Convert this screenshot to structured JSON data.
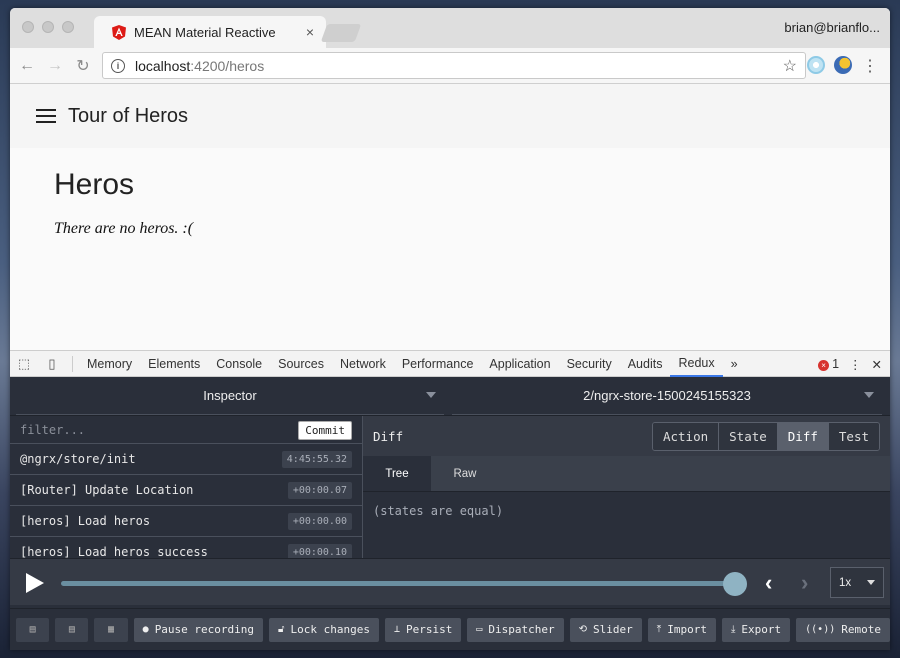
{
  "browser": {
    "tab_title": "MEAN Material Reactive",
    "profile": "brian@brianflo...",
    "url_host": "localhost",
    "url_path": ":4200/heros"
  },
  "app": {
    "title": "Tour of Heros",
    "heading": "Heros",
    "empty_message": "There are no heros. :("
  },
  "devtools": {
    "tabs": [
      "Memory",
      "Elements",
      "Console",
      "Sources",
      "Network",
      "Performance",
      "Application",
      "Security",
      "Audits",
      "Redux"
    ],
    "active_tab": "Redux",
    "more": "»",
    "error_count": "1"
  },
  "redux": {
    "monitor": "Inspector",
    "instance": "2/ngrx-store-1500245155323",
    "filter_placeholder": "filter...",
    "commit_label": "Commit",
    "actions": [
      {
        "name": "@ngrx/store/init",
        "time": "4:45:55.32"
      },
      {
        "name": "[Router] Update Location",
        "time": "+00:00.07"
      },
      {
        "name": "[heros] Load heros",
        "time": "+00:00.00"
      },
      {
        "name": "[heros] Load heros success",
        "time": "+00:00.10"
      }
    ],
    "panel_title": "Diff",
    "modes": [
      "Action",
      "State",
      "Diff",
      "Test"
    ],
    "active_mode": "Diff",
    "subtabs": [
      "Tree",
      "Raw"
    ],
    "active_subtab": "Tree",
    "diff_message": "(states are equal)",
    "speed": "1x",
    "slider_position": 1.0,
    "bottom_buttons": [
      "Pause recording",
      "Lock changes",
      "Persist",
      "Dispatcher",
      "Slider",
      "Import",
      "Export",
      "Remote"
    ]
  }
}
